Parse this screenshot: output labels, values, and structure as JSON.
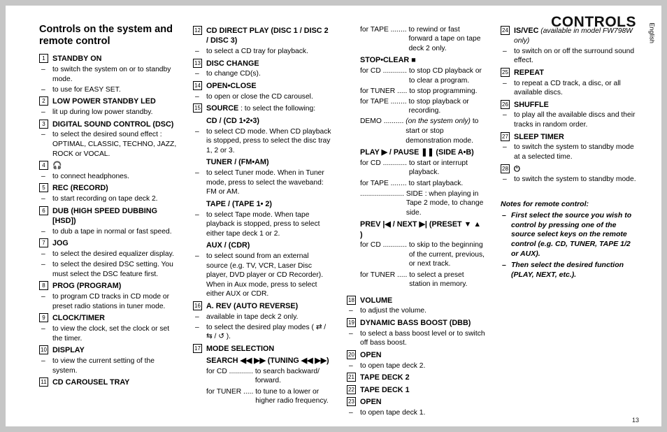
{
  "header": {
    "title": "CONTROLS"
  },
  "lang": "English",
  "page_num": "13",
  "section_heading": "Controls on the system and remote control",
  "col1": {
    "i1": {
      "n": "1",
      "label": "STANDBY ON",
      "d1": "to switch the system on or to standby mode.",
      "d2": "to use for EASY SET."
    },
    "i2": {
      "n": "2",
      "label": "LOW POWER STANDBY LED",
      "d1": "lit up during low power standby."
    },
    "i3": {
      "n": "3",
      "label": "DIGITAL SOUND CONTROL  (DSC)",
      "d1": "to select the desired sound effect : OPTIMAL, CLASSIC, TECHNO, JAZZ, ROCK or VOCAL."
    },
    "i4": {
      "n": "4",
      "label": "🎧",
      "d1": "to connect headphones."
    },
    "i5": {
      "n": "5",
      "label": "REC (RECORD)",
      "d1": "to start recording on tape deck 2."
    },
    "i6": {
      "n": "6",
      "label": "DUB (HIGH SPEED DUBBING [HSD])",
      "d1": "to dub a tape in normal or fast speed."
    },
    "i7": {
      "n": "7",
      "label": "JOG",
      "d1": "to select the desired equalizer display.",
      "d2": "to select the desired DSC setting. You must select the DSC feature first."
    },
    "i8": {
      "n": "8",
      "label": "PROG (PROGRAM)",
      "d1": "to program CD tracks in CD mode or preset radio stations in tuner mode."
    },
    "i9": {
      "n": "9",
      "label": "CLOCK/TIMER",
      "d1": "to view the clock, set the clock or set the timer."
    },
    "i10": {
      "n": "10",
      "label": "DISPLAY",
      "d1": "to view the current setting of the system."
    },
    "i11": {
      "n": "11",
      "label": "CD CAROUSEL TRAY"
    }
  },
  "col2": {
    "i12": {
      "n": "12",
      "label": "CD DIRECT PLAY (DISC 1 / DISC 2 / DISC 3)",
      "d1": "to select a CD tray for playback."
    },
    "i13": {
      "n": "13",
      "label": "DISC CHANGE",
      "d1": "to change CD(s)."
    },
    "i14": {
      "n": "14",
      "label": "OPEN•CLOSE",
      "d1": "to open or close the CD carousel."
    },
    "i15": {
      "n": "15",
      "label": "SOURCE",
      "label2": " : to select the following:"
    },
    "s1": {
      "label": "CD / (CD 1•2•3)",
      "d1": "to select CD mode. When CD playback is stopped, press to select the disc tray 1, 2 or 3."
    },
    "s2": {
      "label": "TUNER / (FM•AM)",
      "d1": "to select Tuner mode. When in Tuner mode, press to select the waveband: FM or AM."
    },
    "s3": {
      "label": "TAPE / (TAPE 1• 2)",
      "d1": "to select Tape mode. When tape playback is stopped, press to select either tape deck 1 or 2."
    },
    "s4": {
      "label": "AUX / (CDR)",
      "d1": "to select sound from an external source (e.g. TV, VCR, Laser Disc player, DVD player or CD Recorder). When in Aux mode, press to select either AUX or CDR."
    },
    "i16": {
      "n": "16",
      "label": "A. REV (AUTO REVERSE)",
      "d1": "available in tape deck 2 only.",
      "d2": "to select the desired play modes ( ⇄ / ⇆ / ↺ )."
    },
    "i17": {
      "n": "17",
      "label": "MODE SELECTION"
    },
    "s5": {
      "label": "SEARCH ◀◀  ▶▶ (TUNING ◀◀  ▶▶)",
      "kv1": {
        "k": "for CD ............ ",
        "v": "to search backward/ forward."
      },
      "kv2": {
        "k": "for TUNER ..... ",
        "v": "to tune to a lower or higher radio frequency."
      }
    }
  },
  "col3": {
    "kv_tape": {
      "k": "for TAPE ........ ",
      "v": "to rewind or fast forward a tape on tape deck 2 only."
    },
    "s1": {
      "label": "STOP•CLEAR  ■",
      "kv1": {
        "k": "for CD ............ ",
        "v": "to stop CD playback or to clear a program."
      },
      "kv2": {
        "k": "for TUNER ..... ",
        "v": "to stop programming."
      },
      "kv3": {
        "k": "for TAPE ........ ",
        "v": "to stop playback or recording."
      },
      "kv4": {
        "k": "DEMO .......... ",
        "i": "(on the system only)",
        "v": " to start or stop demonstration mode."
      }
    },
    "s2": {
      "label": "PLAY  ▶  /  PAUSE ❚❚ (SIDE A•B)",
      "kv1": {
        "k": "for CD ............ ",
        "v": "to start or interrupt playback."
      },
      "kv2": {
        "k": "for TAPE ........ ",
        "v": "to start playback."
      },
      "kv3": {
        "k": "...................... ",
        "v": "SIDE : when playing in Tape 2 mode, to change side."
      }
    },
    "s3": {
      "label": "PREV  |◀ / NEXT  ▶| (PRESET ▼ ▲ )",
      "kv1": {
        "k": "for CD ............ ",
        "v": "to skip to the beginning of the current, previous, or next track."
      },
      "kv2": {
        "k": "for TUNER ..... ",
        "v": "to select a preset station in memory."
      }
    },
    "i18": {
      "n": "18",
      "label": "VOLUME",
      "d1": "to adjust the volume."
    },
    "i19": {
      "n": "19",
      "label": "DYNAMIC BASS BOOST  (DBB)",
      "d1": "to select a bass boost level or to switch off bass boost."
    },
    "i20": {
      "n": "20",
      "label": "OPEN",
      "d1": "to open tape deck 2."
    },
    "i21": {
      "n": "21",
      "label": "TAPE DECK 2"
    },
    "i22": {
      "n": "22",
      "label": "TAPE DECK 1"
    },
    "i23": {
      "n": "23",
      "label": "OPEN",
      "d1": "to open tape deck 1."
    }
  },
  "col4": {
    "i24": {
      "n": "24",
      "label": "IS/VEC",
      "i": " (available in model FW798W only)",
      "d1": "to switch on or off the surround sound effect."
    },
    "i25": {
      "n": "25",
      "label": "REPEAT",
      "d1": "to repeat a CD track, a disc, or all available discs."
    },
    "i26": {
      "n": "26",
      "label": "SHUFFLE",
      "d1": "to play all the available discs and their tracks in random order."
    },
    "i27": {
      "n": "27",
      "label": "SLEEP TIMER",
      "d1": "to switch the system to standby mode at a selected time."
    },
    "i28": {
      "n": "28",
      "label": "⏻",
      "d1": "to switch the system to standby mode."
    },
    "notes": {
      "heading": "Notes for remote control:",
      "p1": "First select the source you wish to control by pressing one of the source select keys on the remote control (e.g. CD, TUNER, TAPE 1/2 or AUX).",
      "p2": "Then select the desired function (PLAY, NEXT, etc.)."
    }
  }
}
